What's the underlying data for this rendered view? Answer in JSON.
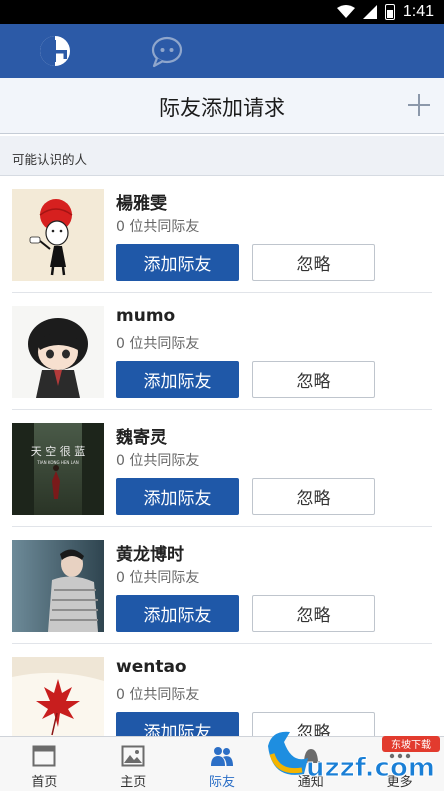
{
  "status_bar": {
    "time": "1:41"
  },
  "page": {
    "title": "际友添加请求"
  },
  "section": {
    "label": "可能认识的人"
  },
  "list": [
    {
      "name": "楊雅雯",
      "mutual": "0 位共同际友",
      "add_label": "添加际友",
      "ignore_label": "忽略"
    },
    {
      "name": "mumo",
      "mutual": "0 位共同际友",
      "add_label": "添加际友",
      "ignore_label": "忽略"
    },
    {
      "name": "魏寄灵",
      "mutual": "0 位共同际友",
      "add_label": "添加际友",
      "ignore_label": "忽略",
      "avatar_text": "天 空 很 蓝",
      "avatar_subtext": "TIAN KONG HEN LAN"
    },
    {
      "name": "黄龙博时",
      "mutual": "0 位共同际友",
      "add_label": "添加际友",
      "ignore_label": "忽略"
    },
    {
      "name": "wentao",
      "mutual": "0 位共同际友",
      "add_label": "添加际友",
      "ignore_label": "忽略"
    }
  ],
  "bottom_nav": [
    {
      "label": "首页",
      "icon": "home-icon",
      "active": false
    },
    {
      "label": "主页",
      "icon": "image-icon",
      "active": false
    },
    {
      "label": "际友",
      "icon": "friends-icon",
      "active": true
    },
    {
      "label": "通知",
      "icon": "bell-icon",
      "active": false
    },
    {
      "label": "更多",
      "icon": "more-icon",
      "active": false
    }
  ],
  "watermark": {
    "text": "uzzf.com",
    "badge": "东坡下载"
  },
  "colors": {
    "primary": "#2c5aa7",
    "button": "#1f58a8",
    "active_tab": "#2c6fc6"
  }
}
